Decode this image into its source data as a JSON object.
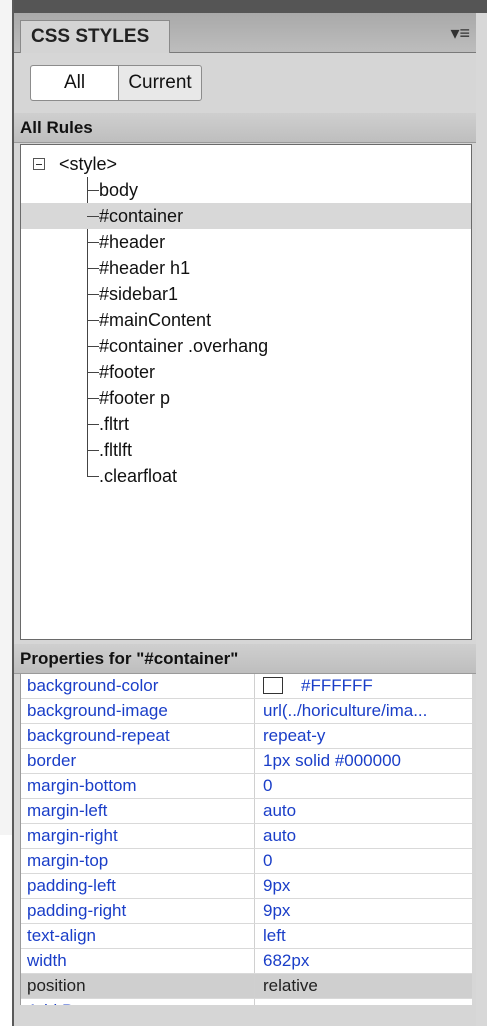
{
  "panel": {
    "tab_label": "CSS STYLES",
    "menu_icon": "panel-menu-icon"
  },
  "toggle": {
    "all_label": "All",
    "current_label": "Current",
    "selected": "All"
  },
  "rules_header": "All Rules",
  "tree": {
    "root_label": "<style>",
    "items": [
      {
        "label": "body",
        "selected": false
      },
      {
        "label": "#container",
        "selected": true
      },
      {
        "label": "#header",
        "selected": false
      },
      {
        "label": "#header h1",
        "selected": false
      },
      {
        "label": "#sidebar1",
        "selected": false
      },
      {
        "label": "#mainContent",
        "selected": false
      },
      {
        "label": "#container .overhang",
        "selected": false
      },
      {
        "label": "#footer",
        "selected": false
      },
      {
        "label": "#footer p",
        "selected": false
      },
      {
        "label": ".fltrt",
        "selected": false
      },
      {
        "label": ".fltlft",
        "selected": false
      },
      {
        "label": ".clearfloat",
        "selected": false
      }
    ]
  },
  "properties_header": "Properties for \"#container\"",
  "properties": [
    {
      "name": "background-color",
      "value": "#FFFFFF"
    },
    {
      "name": "background-image",
      "value": "url(../horiculture/ima..."
    },
    {
      "name": "background-repeat",
      "value": "repeat-y"
    },
    {
      "name": "border",
      "value": "1px solid #000000"
    },
    {
      "name": "margin-bottom",
      "value": "0"
    },
    {
      "name": "margin-left",
      "value": "auto"
    },
    {
      "name": "margin-right",
      "value": "auto"
    },
    {
      "name": "margin-top",
      "value": "0"
    },
    {
      "name": "padding-left",
      "value": "9px"
    },
    {
      "name": "padding-right",
      "value": "9px"
    },
    {
      "name": "text-align",
      "value": "left"
    },
    {
      "name": "width",
      "value": "682px"
    },
    {
      "name": "position",
      "value": "relative"
    }
  ],
  "add_property_label": "Add Property",
  "colors": {
    "link_blue": "#1a3ec8",
    "selection_gray": "#d8d8d8",
    "swatch": "#FFFFFF"
  }
}
